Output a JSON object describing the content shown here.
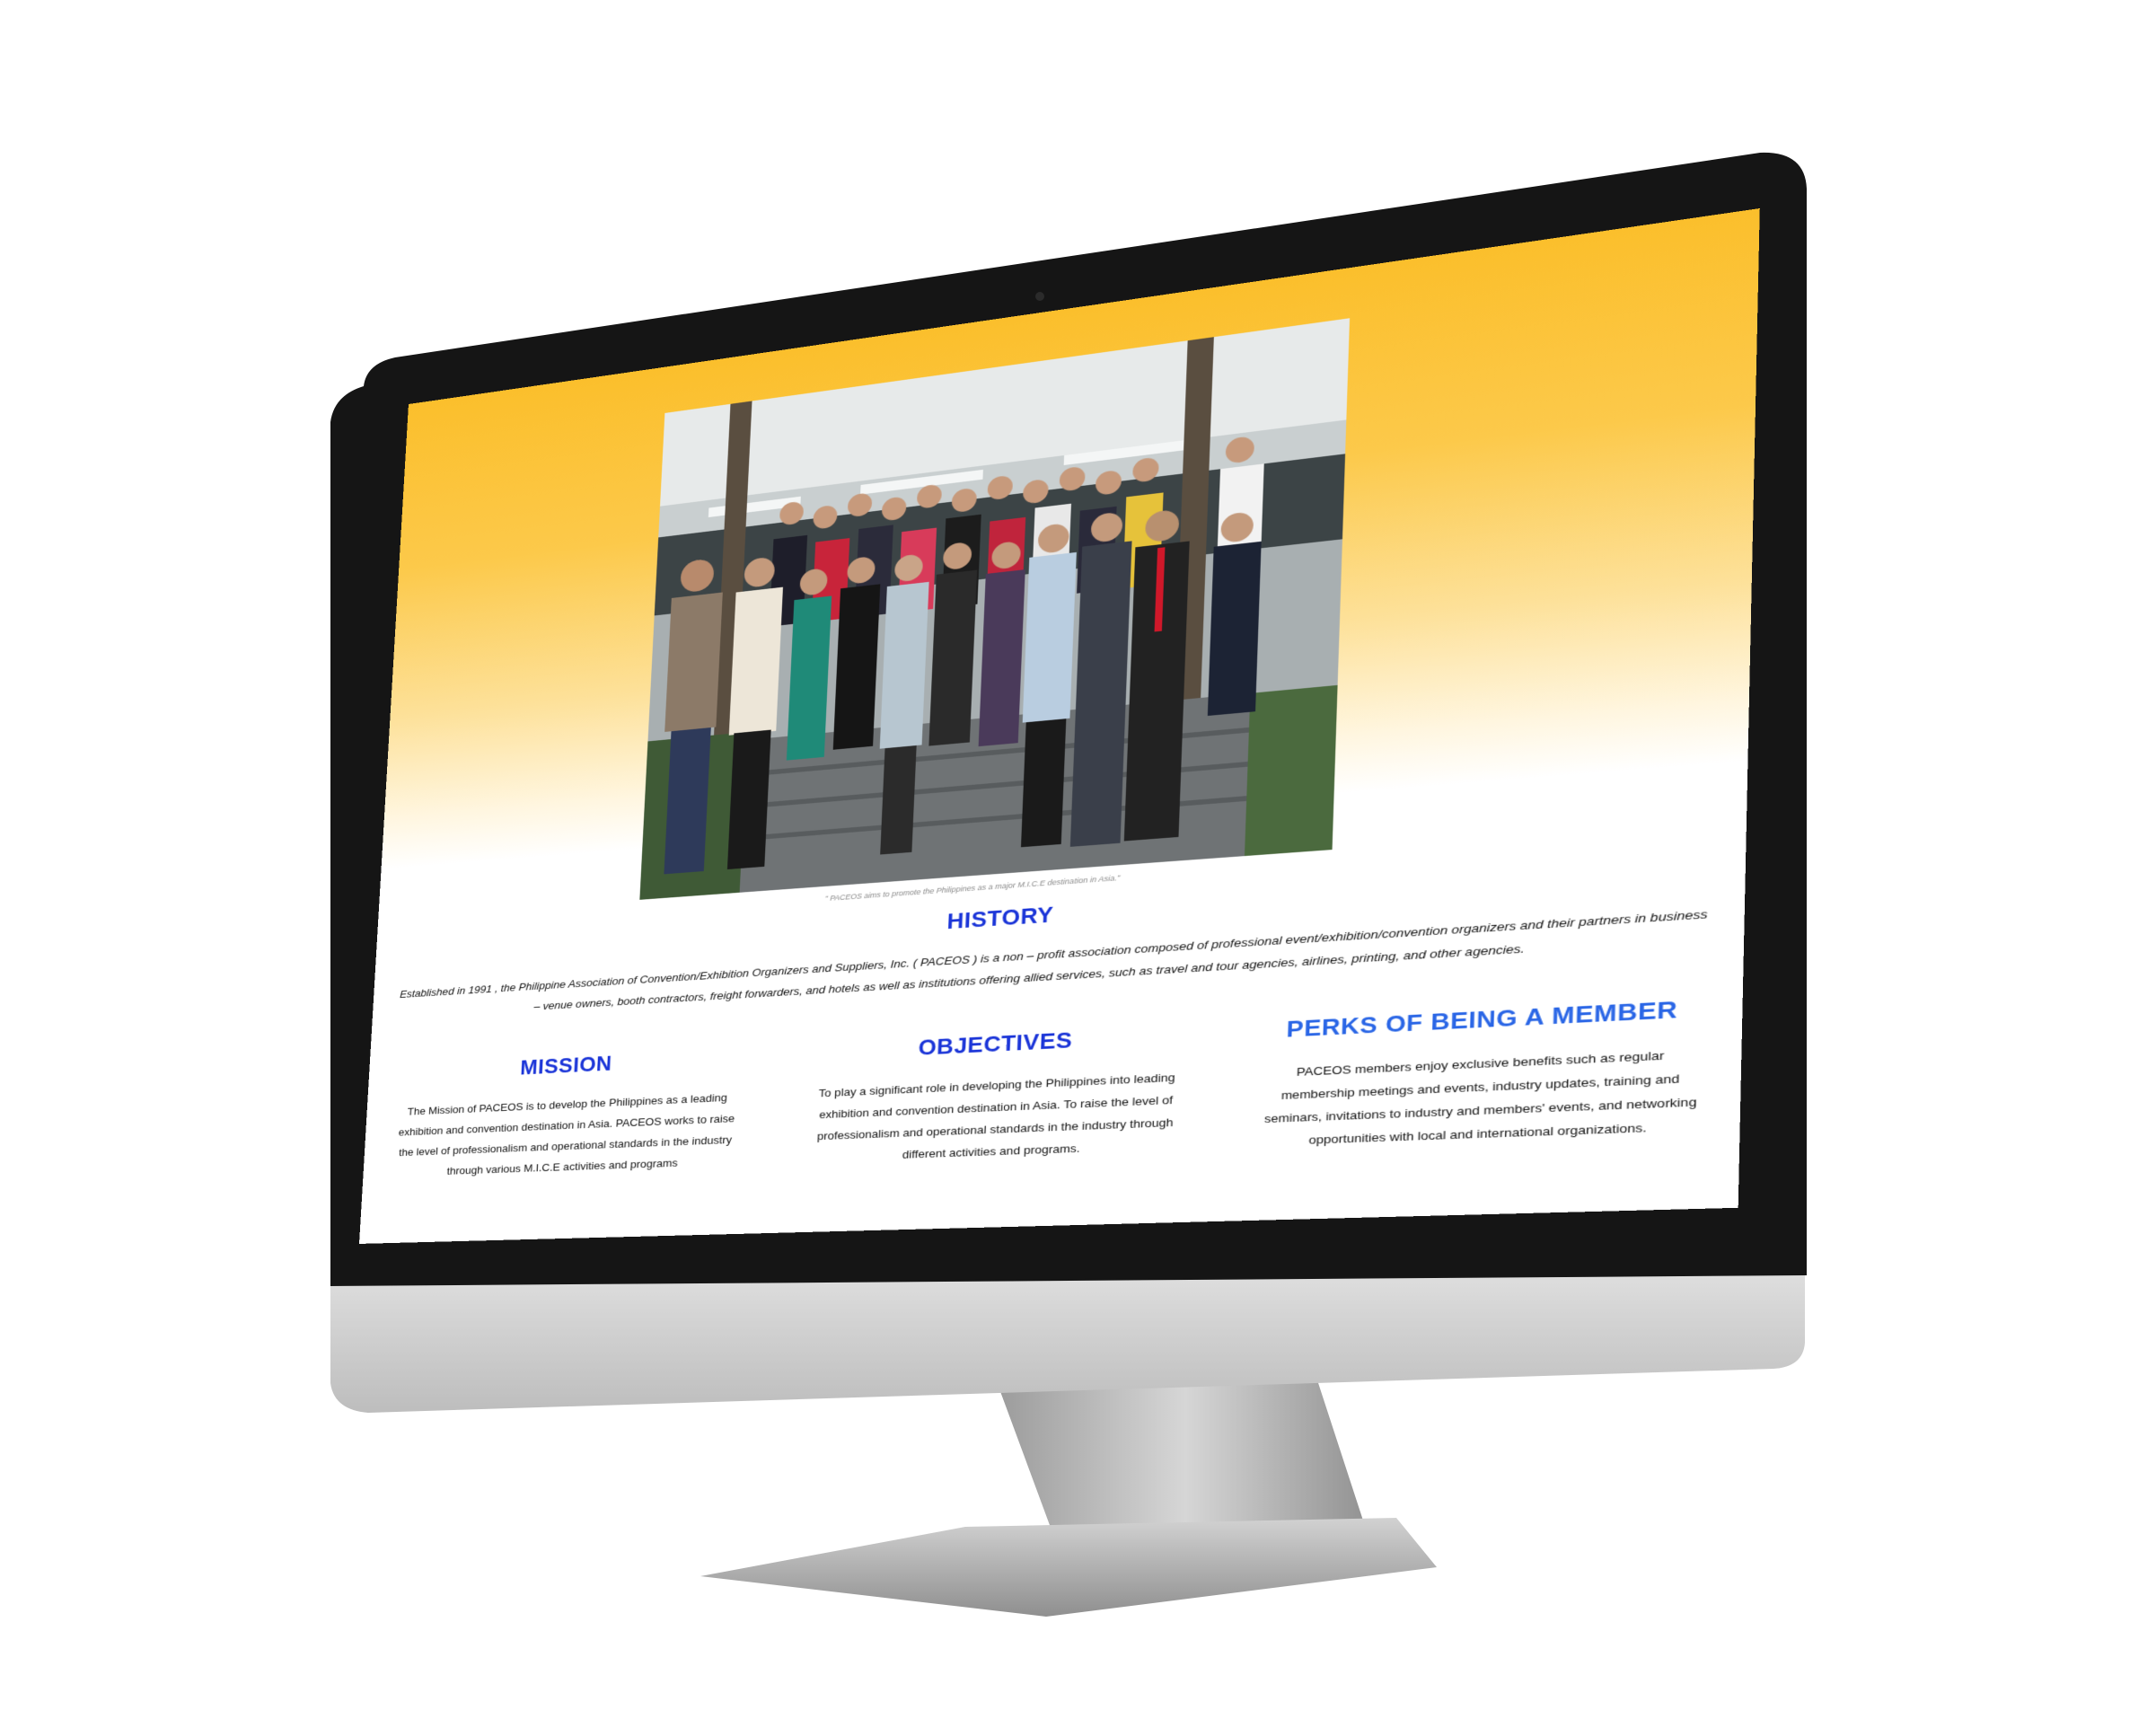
{
  "hero": {
    "caption": "\" PACEOS aims to promote the Philippines as a major M.I.C.E destination in Asia.\""
  },
  "history": {
    "title": "HISTORY",
    "text": "Established in 1991 , the Philippine Association of Convention/Exhibition Organizers and Suppliers, Inc. ( PACEOS ) is a non – profit association composed of professional event/exhibition/convention organizers and their partners in business – venue owners, booth contractors, freight forwarders, and hotels as well as institutions offering allied services, such as travel and tour agencies, airlines, printing, and other agencies."
  },
  "mission": {
    "title": "MISSION",
    "text": "The Mission of PACEOS is to develop the Philippines as a leading exhibition and convention destination in Asia. PACEOS works to raise the level of professionalism and operational standards in the industry through various M.I.C.E activities and programs"
  },
  "objectives": {
    "title": "OBJECTIVES",
    "text": "To play a significant role in developing the Philippines into leading exhibition and convention destination in Asia. To raise the level of professionalism and operational standards in the industry through different activities and programs."
  },
  "perks": {
    "title": "PERKS OF BEING A MEMBER",
    "text": "PACEOS members enjoy exclusive benefits such as regular membership meetings and events, industry updates, training and seminars, invitations to industry and members' events, and networking opportunities with local and international organizations."
  },
  "colors": {
    "heading_blue": "#1b35d8",
    "heading_light_blue": "#2a66e6",
    "gradient_top": "#fbbf2c"
  }
}
